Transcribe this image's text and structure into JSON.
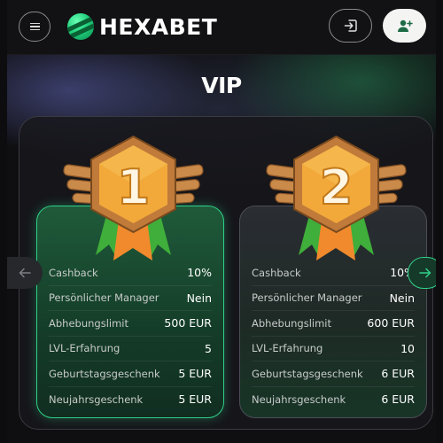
{
  "header": {
    "brand": "HEXABET"
  },
  "page": {
    "title": "VIP"
  },
  "levels": [
    {
      "level": "1",
      "rows": [
        {
          "label": "Cashback",
          "value": "10%"
        },
        {
          "label": "Persönlicher Manager",
          "value": "Nein"
        },
        {
          "label": "Abhebungslimit",
          "value": "500 EUR"
        },
        {
          "label": "LVL-Erfahrung",
          "value": "5"
        },
        {
          "label": "Geburtstagsgeschenk",
          "value": "5 EUR"
        },
        {
          "label": "Neujahrsgeschenk",
          "value": "5 EUR"
        }
      ]
    },
    {
      "level": "2",
      "rows": [
        {
          "label": "Cashback",
          "value": "10%"
        },
        {
          "label": "Persönlicher Manager",
          "value": "Nein"
        },
        {
          "label": "Abhebungslimit",
          "value": "600 EUR"
        },
        {
          "label": "LVL-Erfahrung",
          "value": "10"
        },
        {
          "label": "Geburtstagsgeschenk",
          "value": "6 EUR"
        },
        {
          "label": "Neujahrsgeschenk",
          "value": "6 EUR"
        }
      ]
    }
  ],
  "icons": {
    "menu": "hamburger-menu-icon",
    "login": "login-arrow-icon",
    "register": "add-user-icon",
    "prev": "arrow-left-icon",
    "next": "arrow-right-icon"
  },
  "colors": {
    "accent": "#2fd089",
    "medal_gold": "#f2a93a",
    "medal_bronze": "#c07a3a",
    "ribbon_green": "#3fae3a",
    "ribbon_orange": "#f08a2c"
  }
}
